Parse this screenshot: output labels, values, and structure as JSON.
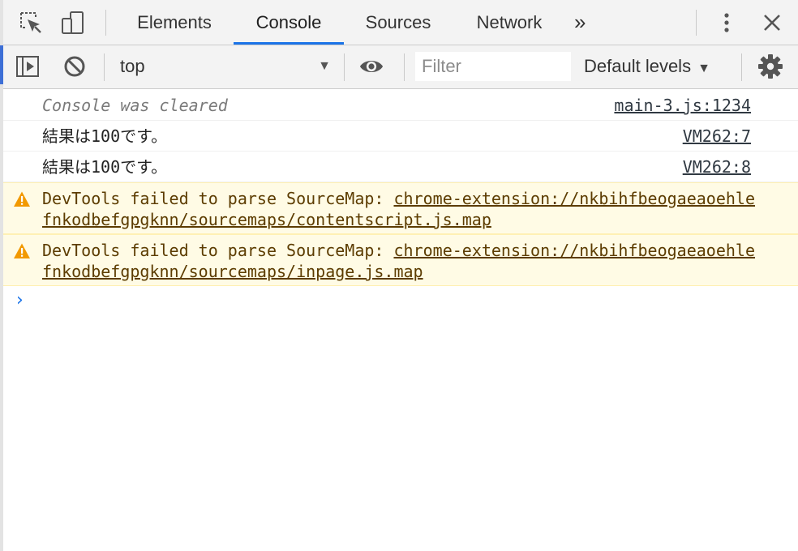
{
  "tabs": [
    {
      "label": "Elements",
      "active": false
    },
    {
      "label": "Console",
      "active": true
    },
    {
      "label": "Sources",
      "active": false
    },
    {
      "label": "Network",
      "active": false
    }
  ],
  "overflow_glyph": "»",
  "close_glyph": "✕",
  "toolbar": {
    "context": "top",
    "filter_placeholder": "Filter",
    "levels_label": "Default levels",
    "dropdown_glyph": "▼"
  },
  "messages": {
    "cleared": {
      "text": "Console was cleared",
      "source": "main-3.js:1234"
    },
    "log1": {
      "text": "結果は100です。",
      "source": "VM262:7"
    },
    "log2": {
      "text": "結果は100です。",
      "source": "VM262:8"
    },
    "warn1": {
      "prefix": "DevTools failed to parse SourceMap: ",
      "url": "chrome-extension://nkbihfbeogaeaoehlefnkodbefgpgknn/sourcemaps/contentscript.js.map"
    },
    "warn2": {
      "prefix": "DevTools failed to parse SourceMap: ",
      "url": "chrome-extension://nkbihfbeogaeaoehlefnkodbefgpgknn/sourcemaps/inpage.js.map"
    }
  },
  "prompt_glyph": "›",
  "colors": {
    "accent": "#1a73e8",
    "warning_bg": "#fffbe5",
    "warning_text": "#5c3c00",
    "warning_icon": "#f29900"
  },
  "icons": {
    "inspect": "inspect-element-icon",
    "device": "device-toolbar-icon",
    "more": "kebab-menu-icon",
    "close": "close-icon",
    "sidebar": "show-sidebar-icon",
    "clear": "clear-console-icon",
    "eye": "live-expression-icon",
    "settings": "gear-icon",
    "warning": "warning-icon"
  }
}
